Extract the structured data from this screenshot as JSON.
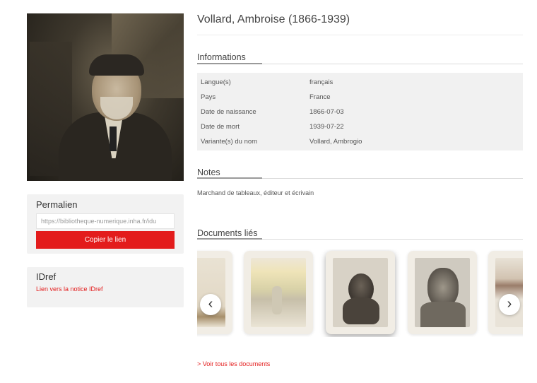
{
  "page": {
    "title": "Vollard, Ambroise (1866-1939)"
  },
  "permalink": {
    "heading": "Permalien",
    "url": "https://bibliotheque-numerique.inha.fr/idu",
    "copy_label": "Copier le lien"
  },
  "idref": {
    "heading": "IDref",
    "link_label": "Lien vers la notice IDref"
  },
  "informations": {
    "heading": "Informations",
    "rows": [
      {
        "key": "Langue(s)",
        "value": "français"
      },
      {
        "key": "Pays",
        "value": "France"
      },
      {
        "key": "Date de naissance",
        "value": "1866-07-03"
      },
      {
        "key": "Date de mort",
        "value": "1939-07-22"
      },
      {
        "key": "Variante(s) du nom",
        "value": "Vollard, Ambrogio"
      }
    ]
  },
  "notes": {
    "heading": "Notes",
    "text": "Marchand de tableaux, éditeur et écrivain"
  },
  "documents": {
    "heading": "Documents liés",
    "prev_symbol": "‹",
    "next_symbol": "›",
    "see_all_label": "> Voir tous les documents"
  },
  "colors": {
    "accent": "#e31c1c",
    "panel": "#f2f2f2"
  }
}
